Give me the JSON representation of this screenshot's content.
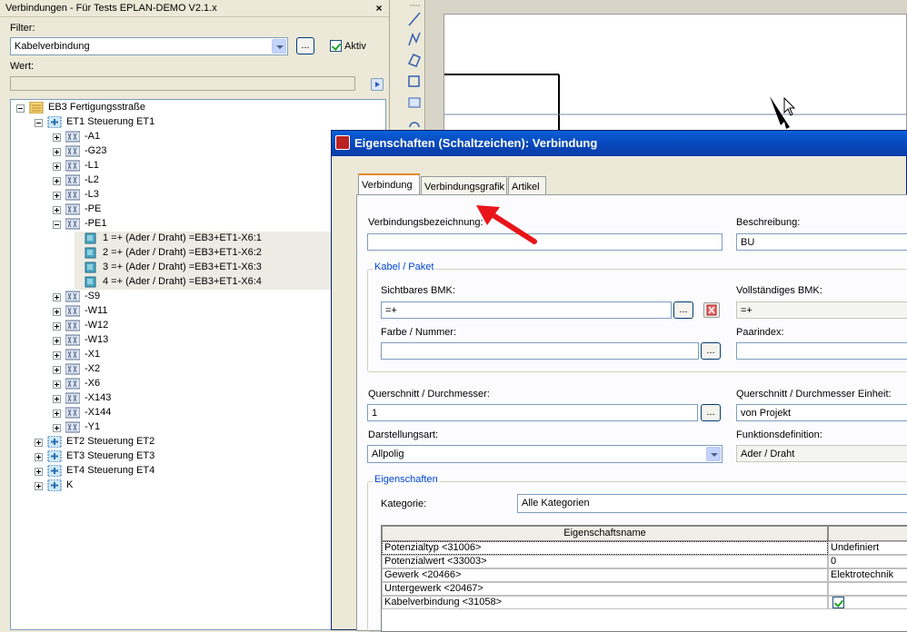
{
  "left_panel": {
    "title": "Verbindungen - Für Tests EPLAN-DEMO V2.1.x",
    "close_glyph": "×",
    "filter_label": "Filter:",
    "filter_value": "Kabelverbindung",
    "filter_browse": "...",
    "aktiv_label": "Aktiv",
    "wert_label": "Wert:",
    "wert_value": "",
    "tree": [
      {
        "label": "EB3 Fertigungsstraße",
        "level": 0,
        "expander": "minus",
        "icon": "project-icon"
      },
      {
        "label": "ET1 Steuerung ET1",
        "level": 1,
        "expander": "minus",
        "icon": "location-icon"
      },
      {
        "label": "-A1",
        "level": 2,
        "expander": "plus",
        "icon": "device-icon"
      },
      {
        "label": "-G23",
        "level": 2,
        "expander": "plus",
        "icon": "device-icon"
      },
      {
        "label": "-L1",
        "level": 2,
        "expander": "plus",
        "icon": "device-icon"
      },
      {
        "label": "-L2",
        "level": 2,
        "expander": "plus",
        "icon": "device-icon"
      },
      {
        "label": "-L3",
        "level": 2,
        "expander": "plus",
        "icon": "device-icon"
      },
      {
        "label": "-PE",
        "level": 2,
        "expander": "plus",
        "icon": "device-icon"
      },
      {
        "label": "-PE1",
        "level": 2,
        "expander": "minus",
        "icon": "device-icon"
      },
      {
        "label": "1 =+  (Ader / Draht) =EB3+ET1-X6:1",
        "level": 3,
        "expander": "none",
        "icon": "connection-icon",
        "highlight": true
      },
      {
        "label": "2 =+  (Ader / Draht) =EB3+ET1-X6:2",
        "level": 3,
        "expander": "none",
        "icon": "connection-icon",
        "highlight": true
      },
      {
        "label": "3 =+  (Ader / Draht) =EB3+ET1-X6:3",
        "level": 3,
        "expander": "none",
        "icon": "connection-icon",
        "highlight": true
      },
      {
        "label": "4 =+  (Ader / Draht) =EB3+ET1-X6:4",
        "level": 3,
        "expander": "none",
        "icon": "connection-icon",
        "highlight": true
      },
      {
        "label": "-S9",
        "level": 2,
        "expander": "plus",
        "icon": "device-icon"
      },
      {
        "label": "-W11",
        "level": 2,
        "expander": "plus",
        "icon": "device-icon"
      },
      {
        "label": "-W12",
        "level": 2,
        "expander": "plus",
        "icon": "device-icon"
      },
      {
        "label": "-W13",
        "level": 2,
        "expander": "plus",
        "icon": "device-icon"
      },
      {
        "label": "-X1",
        "level": 2,
        "expander": "plus",
        "icon": "device-icon"
      },
      {
        "label": "-X2",
        "level": 2,
        "expander": "plus",
        "icon": "device-icon"
      },
      {
        "label": "-X6",
        "level": 2,
        "expander": "plus",
        "icon": "device-icon"
      },
      {
        "label": "-X143",
        "level": 2,
        "expander": "plus",
        "icon": "device-icon"
      },
      {
        "label": "-X144",
        "level": 2,
        "expander": "plus",
        "icon": "device-icon"
      },
      {
        "label": "-Y1",
        "level": 2,
        "expander": "plus",
        "icon": "device-icon"
      },
      {
        "label": "ET2 Steuerung ET2",
        "level": 1,
        "expander": "plus",
        "icon": "location-icon"
      },
      {
        "label": "ET3 Steuerung ET3",
        "level": 1,
        "expander": "plus",
        "icon": "location-icon"
      },
      {
        "label": "ET4 Steuerung ET4",
        "level": 1,
        "expander": "plus",
        "icon": "location-icon"
      },
      {
        "label": "K",
        "level": 1,
        "expander": "plus",
        "icon": "location-icon"
      }
    ]
  },
  "dialog": {
    "title": "Eigenschaften (Schaltzeichen): Verbindung",
    "tabs": [
      "Verbindung",
      "Verbindungsgrafik",
      "Artikel"
    ],
    "active_tab": "Verbindung",
    "fields": {
      "verbindungsbezeichnung_label": "Verbindungsbezeichnung:",
      "verbindungsbezeichnung_value": "",
      "beschreibung_label": "Beschreibung:",
      "beschreibung_value": "BU",
      "kabel_group_title": "Kabel / Paket",
      "sichtbares_bmk_label": "Sichtbares BMK:",
      "sichtbares_bmk_value": "=+",
      "vollstaendiges_bmk_label": "Vollständiges BMK:",
      "vollstaendiges_bmk_value": "=+",
      "farbe_label": "Farbe / Nummer:",
      "farbe_value": "",
      "paarindex_label": "Paarindex:",
      "paarindex_value": "",
      "querschnitt_label": "Querschnitt / Durchmesser:",
      "querschnitt_value": "1",
      "querschnitt_einheit_label": "Querschnitt / Durchmesser Einheit:",
      "querschnitt_einheit_value": "von Projekt",
      "darstellungsart_label": "Darstellungsart:",
      "darstellungsart_value": "Allpolig",
      "funktionsdefinition_label": "Funktionsdefinition:",
      "funktionsdefinition_value": "Ader / Draht",
      "browse": "..."
    },
    "eigenschaften": {
      "group_title": "Eigenschaften",
      "kategorie_label": "Kategorie:",
      "kategorie_value": "Alle Kategorien",
      "column_header": "Eigenschaftsname",
      "rows": [
        {
          "name": "Potenzialtyp <31006>",
          "value": "Undefiniert"
        },
        {
          "name": "Potenzialwert <33003>",
          "value": "0"
        },
        {
          "name": "Gewerk <20466>",
          "value": "Elektrotechnik"
        },
        {
          "name": "Untergewerk <20467>",
          "value": ""
        },
        {
          "name": "Kabelverbindung <31058>",
          "value": "",
          "checkbox": true
        }
      ]
    }
  },
  "colors": {
    "dialog_title_bar": "#0a5fd8",
    "arrow": "#e8141a",
    "group_title": "#0046d5",
    "tab_highlight": "#e68b2c"
  }
}
